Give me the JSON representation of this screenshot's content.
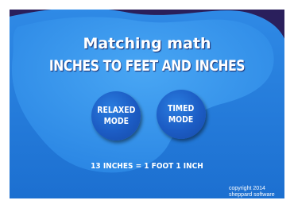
{
  "game": {
    "title": "Matching math",
    "subtitle": "INCHES TO FEET AND INCHES",
    "buttons": {
      "relaxed_label": "RELAXED\nMODE",
      "timed_label": "TIMED\nMODE"
    },
    "equation": "13 INCHES = 1 FOOT 1 INCH",
    "copyright": {
      "line1": "copyright 2014",
      "line2": "sheppard software"
    }
  },
  "colors": {
    "frame": "#2a1f5c",
    "background_outer": "#1e78d8",
    "background_inner": "#3a9cf0",
    "button": "#1c5cc4",
    "text": "#ffffff"
  }
}
